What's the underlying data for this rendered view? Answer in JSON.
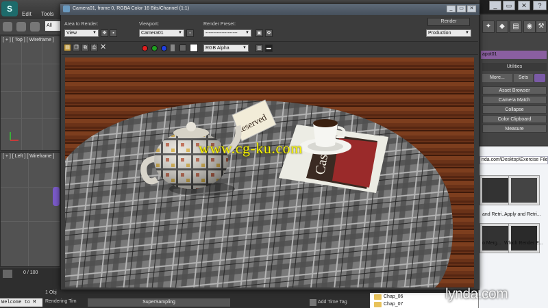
{
  "max_app": {
    "logo": "S",
    "menu": [
      "Edit",
      "Tools"
    ],
    "selection_filter": "All",
    "viewport_top_label": "[ + ] [ Top ] [ Wireframe ]",
    "viewport_left_label": "[ + ] [ Left ] [ Wireframe ]",
    "timeline_counter": "0 / 100",
    "maxscript_text": "Welcome to M",
    "status_objects": "1 Obj",
    "status_rendering": "Rendering Tim",
    "supersampling": "SuperSampling",
    "add_time_tag": "Add Time Tag"
  },
  "command_panel": {
    "object_name": "apot01",
    "utilities_header": "Utilities",
    "more_label": "More...",
    "sets_label": "Sets",
    "buttons": [
      "Asset Browser",
      "Camera Match",
      "Collapse",
      "Color Clipboard",
      "Measure"
    ]
  },
  "explorer": {
    "path": "nda.com\\Desktop\\Exercise File",
    "thumbnails": [
      {
        "label": "and Retri..."
      },
      {
        "label": "Apply and Retri..."
      },
      {
        "label": "o Merg..."
      },
      {
        "label": "Which Render E..."
      }
    ],
    "folders": [
      "Chap_06",
      "Chap_07"
    ]
  },
  "render_window": {
    "title": "Camera01, frame 0, RGBA Color 16 Bits/Channel (1:1)",
    "area_to_render_label": "Area to Render:",
    "area_to_render_value": "View",
    "viewport_label": "Viewport:",
    "viewport_value": "Camera01",
    "render_preset_label": "Render Preset:",
    "render_preset_value": "--------------------",
    "render_button": "Render",
    "production_value": "Production",
    "channel_value": "RGB Alpha",
    "channel_colors": [
      "#e02020",
      "#20a020",
      "#2040e0"
    ]
  },
  "render_image": {
    "reserved_card": "Reserved",
    "coaster_text": "Casa",
    "watermark": "www.cg-ku.com"
  },
  "branding": {
    "lynda": "lynda.com"
  }
}
